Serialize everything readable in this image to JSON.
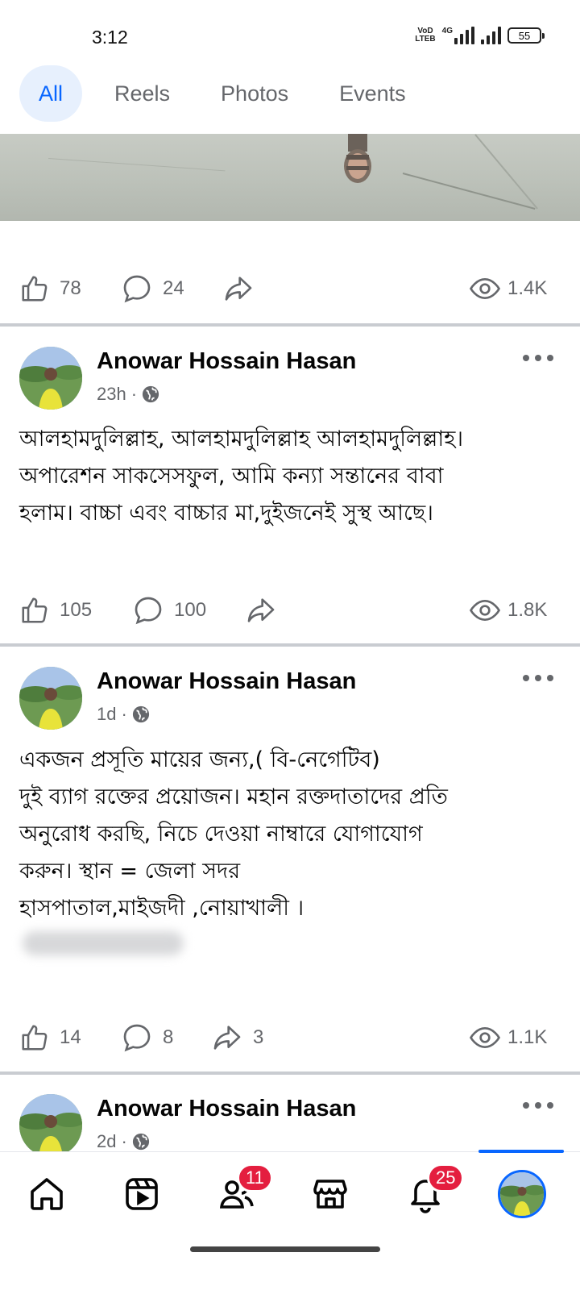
{
  "status_bar": {
    "time": "3:12",
    "volte_top": "VoD",
    "volte_bottom": "LTEB",
    "network": "4G",
    "battery": "55"
  },
  "tabs": [
    {
      "label": "All",
      "active": true
    },
    {
      "label": "Reels",
      "active": false
    },
    {
      "label": "Photos",
      "active": false
    },
    {
      "label": "Events",
      "active": false
    }
  ],
  "posts": [
    {
      "likes": "78",
      "comments": "24",
      "shares": "",
      "views": "1.4K"
    },
    {
      "author": "Anowar Hossain Hasan",
      "time": "23h",
      "text": "আলহামদুলিল্লাহ, আলহামদুলিল্লাহ আলহামদুলিল্লাহ।\nঅপারেশন সাকসেসফুল, আমি কন্যা সন্তানের বাবা\nহলাম। বাচ্চা এবং বাচ্চার মা,দুইজনেই সুস্থ আছে।",
      "likes": "105",
      "comments": "100",
      "shares": "",
      "views": "1.8K"
    },
    {
      "author": "Anowar Hossain Hasan",
      "time": "1d",
      "text": "একজন প্রসূতি মায়ের জন্য,( বি-নেগেটিব)\nদুই ব্যাগ রক্তের প্রয়োজন। মহান রক্তদাতাদের প্রতি\nঅনুরোধ করছি, নিচে দেওয়া নাম্বারে যোগাযোগ\nকরুন। স্থান = জেলা সদর\nহাসপাতাল,মাইজদী ,নোয়াখালী ।",
      "likes": "14",
      "comments": "8",
      "shares": "3",
      "views": "1.1K"
    },
    {
      "author": "Anowar Hossain Hasan",
      "time": "2d"
    }
  ],
  "meta_separator": "·",
  "bottom_nav": {
    "friends_badge": "11",
    "notifications_badge": "25"
  },
  "colors": {
    "accent": "#0866ff",
    "tab_active_bg": "#e7f0fd",
    "muted": "#65676b",
    "badge": "#e41e3f",
    "divider": "#c9ccd1"
  },
  "icons": [
    "thumbs-up-icon",
    "comment-icon",
    "share-icon",
    "eye-icon",
    "globe-icon",
    "more-icon",
    "home-icon",
    "video-icon",
    "friends-icon",
    "marketplace-icon",
    "bell-icon"
  ]
}
